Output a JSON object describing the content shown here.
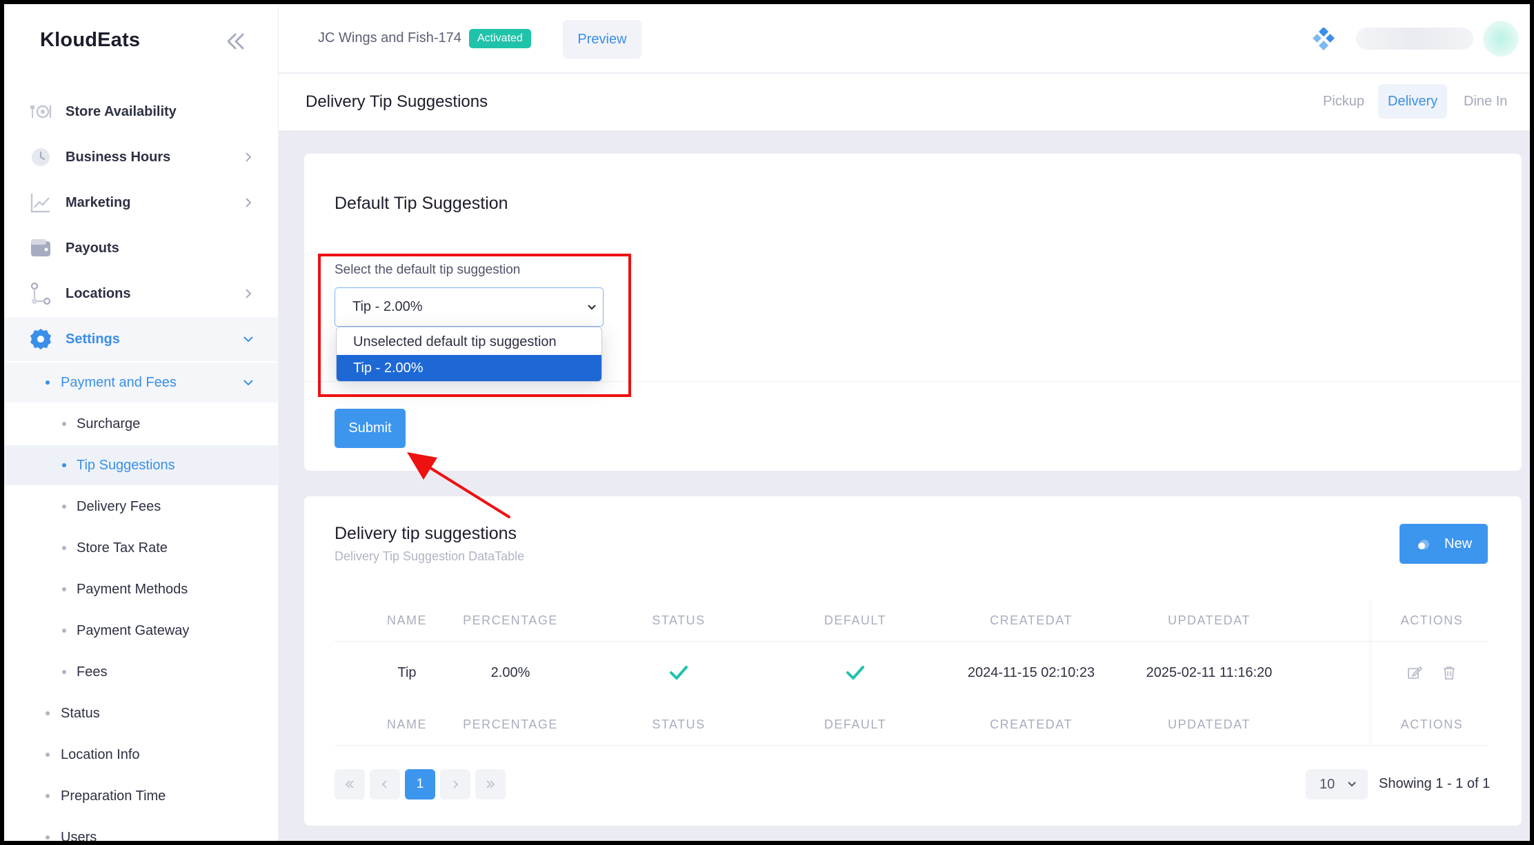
{
  "brand": "KloudEats",
  "sidebar": {
    "items": [
      {
        "label": "Store Availability",
        "icon": "store-icon"
      },
      {
        "label": "Business Hours",
        "icon": "clock-icon"
      },
      {
        "label": "Marketing",
        "icon": "chart-icon"
      },
      {
        "label": "Payouts",
        "icon": "wallet-icon"
      },
      {
        "label": "Locations",
        "icon": "locations-icon"
      },
      {
        "label": "Settings",
        "icon": "gear-icon"
      }
    ],
    "payment_and_fees": "Payment and Fees",
    "payment_children": [
      "Surcharge",
      "Tip Suggestions",
      "Delivery Fees",
      "Store Tax Rate",
      "Payment Methods",
      "Payment Gateway",
      "Fees"
    ],
    "settings_children": [
      "Status",
      "Location Info",
      "Preparation Time",
      "Users"
    ]
  },
  "header": {
    "store_name": "JC Wings and Fish-174",
    "status_badge": "Activated",
    "preview_label": "Preview"
  },
  "subheader": {
    "title": "Delivery Tip Suggestions",
    "tabs": [
      "Pickup",
      "Delivery",
      "Dine In"
    ],
    "active_tab": "Delivery"
  },
  "default_card": {
    "title": "Default Tip Suggestion",
    "field_label": "Select the default tip suggestion",
    "selected_value": "Tip - 2.00%",
    "options": [
      "Unselected default tip suggestion",
      "Tip - 2.00%"
    ],
    "submit_label": "Submit"
  },
  "table_card": {
    "title": "Delivery tip suggestions",
    "subtitle": "Delivery Tip Suggestion DataTable",
    "new_label": "New",
    "columns": [
      "NAME",
      "PERCENTAGE",
      "STATUS",
      "DEFAULT",
      "CREATEDAT",
      "UPDATEDAT",
      "ACTIONS"
    ],
    "rows": [
      {
        "name": "Tip",
        "percentage": "2.00%",
        "status": true,
        "default": true,
        "created_at": "2024-11-15 02:10:23",
        "updated_at": "2025-02-11 11:16:20"
      }
    ],
    "pagination": {
      "current_page": "1",
      "per_page": "10",
      "showing": "Showing 1 - 1 of 1"
    }
  },
  "colors": {
    "accent": "#3d96ee",
    "activated_badge": "#1fc3a9",
    "check": "#1fc3a9",
    "highlight_box": "#ee1111",
    "selected_option": "#1e68d6"
  }
}
